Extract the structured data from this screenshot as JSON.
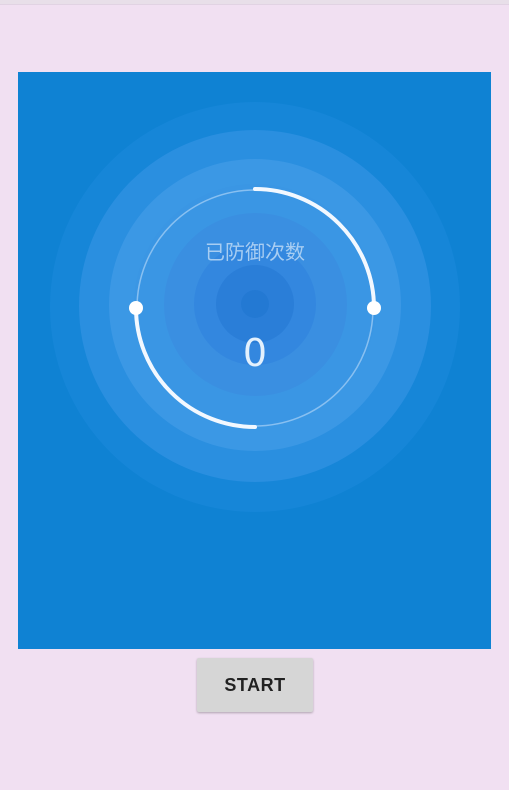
{
  "status_bar": {
    "shown": true
  },
  "defense_panel": {
    "title": "已防御次数",
    "count": "0",
    "colors": {
      "panel_background": "#0f82d3",
      "arc": "#f2f8ff",
      "label_text": "#a7cdf2",
      "count_text": "#e3f1fd"
    }
  },
  "controls": {
    "start_label": "START"
  },
  "page": {
    "background": "#f1e0f2",
    "button_background": "#d6d6d6"
  }
}
